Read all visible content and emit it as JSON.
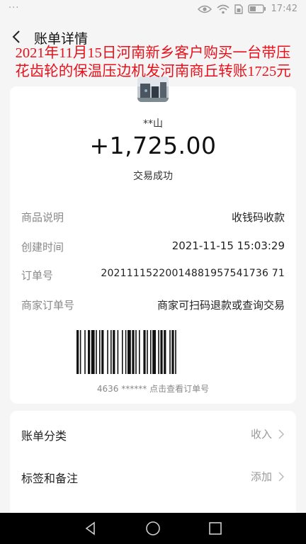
{
  "status_bar": {
    "menu_dots": "···",
    "time": "17:42"
  },
  "header": {
    "back_label": "<",
    "title": "账单详情"
  },
  "overlay_caption": {
    "line1": "2021年11月15日河南新乡客户购买一台带压",
    "line2": "花齿轮的保温压边机发河南商丘转账1725元",
    "color": "#e8101a"
  },
  "transaction": {
    "payee": "**山",
    "amount": "+1,725.00",
    "status": "交易成功"
  },
  "details": [
    {
      "label": "商品说明",
      "value": "收钱码收款"
    },
    {
      "label": "创建时间",
      "value": "2021-11-15 15:03:29"
    },
    {
      "label": "订单号",
      "value": "20211115220014881957541736 71"
    },
    {
      "label": "商家订单号",
      "value": "商家可扫码退款或查询交易"
    }
  ],
  "barcode": {
    "caption": "4636 ****** 点击查看订单号"
  },
  "options": [
    {
      "label": "账单分类",
      "value": "收入"
    },
    {
      "label": "标签和备注",
      "value": "添加"
    }
  ],
  "nav": {
    "back": "back-triangle",
    "home": "home-circle",
    "recent": "recent-square"
  }
}
